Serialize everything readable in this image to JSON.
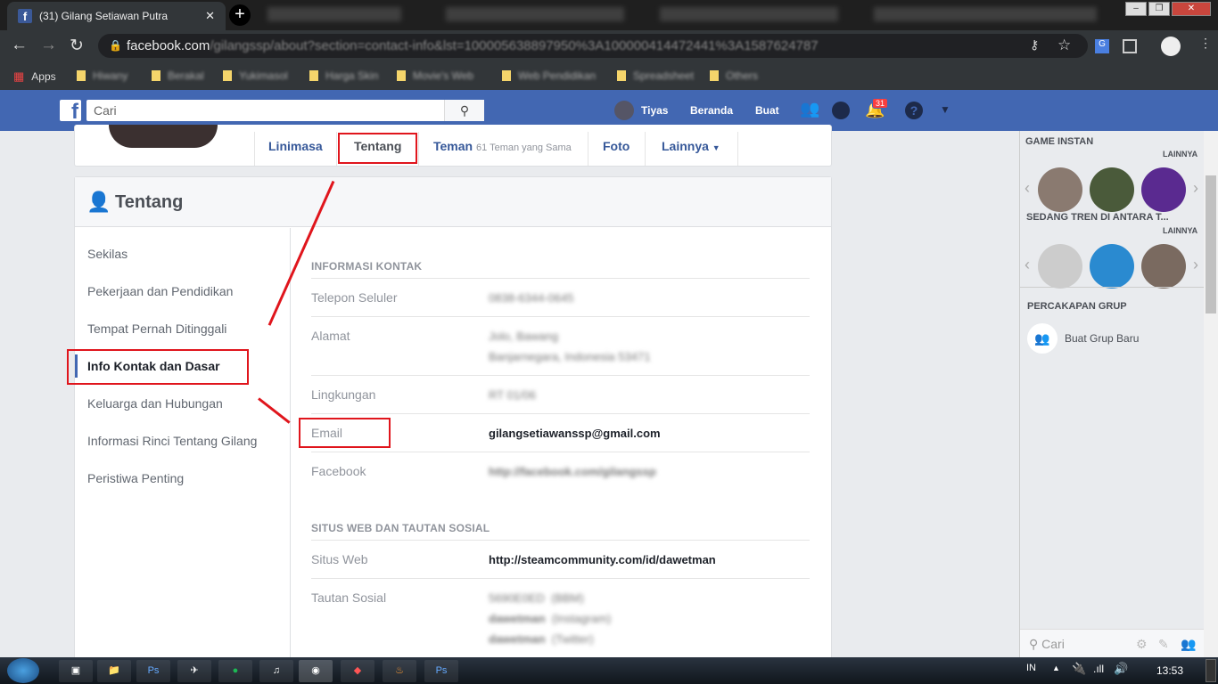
{
  "browser": {
    "tab_title": "(31) Gilang Setiawan Putra",
    "url_host": "facebook.com",
    "url_rest": "/gilangssp/about?section=contact-info&lst=100005638897950%3A100000414472441%3A1587624787",
    "bookmarks": [
      "Apps",
      "Hiwany",
      "Berakal",
      "Yukimasol",
      "Harga Skin",
      "Movie's Web",
      "Web Pendidikan",
      "Spreadsheet",
      "Others"
    ]
  },
  "fb": {
    "search_placeholder": "Cari",
    "user": "Tiyas",
    "home": "Beranda",
    "create": "Buat",
    "notif_count": "31",
    "profile_nav": {
      "timeline": "Linimasa",
      "about": "Tentang",
      "friends": "Teman",
      "friends_sub": "61 Teman yang Sama",
      "photos": "Foto",
      "more": "Lainnya"
    },
    "about_title": "Tentang",
    "about_menu": [
      "Sekilas",
      "Pekerjaan dan Pendidikan",
      "Tempat Pernah Ditinggali",
      "Info Kontak dan Dasar",
      "Keluarga dan Hubungan",
      "Informasi Rinci Tentang Gilang",
      "Peristiwa Penting"
    ],
    "contact": {
      "heading": "INFORMASI KONTAK",
      "rows": [
        {
          "label": "Telepon Seluler",
          "values": [
            "0838-6344-0645"
          ],
          "blurred": true
        },
        {
          "label": "Alamat",
          "values": [
            "Jolo, Bawang",
            "Banjarnegara, Indonesia 53471"
          ],
          "blurred": true
        },
        {
          "label": "Lingkungan",
          "values": [
            "RT 01/06"
          ],
          "blurred": true
        },
        {
          "label": "Email",
          "values": [
            "gilangsetiawanssp@gmail.com"
          ],
          "blurred": false
        },
        {
          "label": "Facebook",
          "values": [
            "http://facebook.com/gilangssp"
          ],
          "blurred": true
        }
      ]
    },
    "web": {
      "heading": "SITUS WEB DAN TAUTAN SOSIAL",
      "site_label": "Situs Web",
      "site": "http://steamcommunity.com/id/dawetman",
      "social_label": "Tautan Sosial",
      "social": [
        {
          "name": "5690E0ED",
          "type": "(BBM)"
        },
        {
          "name": "dawetman",
          "type": "(Instagram)"
        },
        {
          "name": "dawetman",
          "type": "(Twitter)"
        }
      ]
    },
    "sidebar": {
      "games": "GAME INSTAN",
      "more1": "LAINNYA",
      "trending": "SEDANG TREN DI ANTARA T...",
      "more2": "LAINNYA",
      "groups": "PERCAKAPAN GRUP",
      "new_group": "Buat Grup Baru",
      "chat_search": "Cari"
    }
  },
  "taskbar": {
    "lang": "IN",
    "time": "13:53"
  },
  "colors": {
    "fb_blue": "#4267b2",
    "annotation_red": "#e0151c"
  }
}
